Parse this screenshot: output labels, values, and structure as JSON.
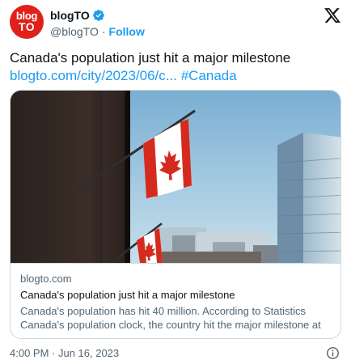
{
  "author": {
    "avatar_line1": "blog",
    "avatar_line2": "TO",
    "display_name": "blogTO",
    "handle": "@blogTO",
    "separator": "·",
    "follow_label": "Follow"
  },
  "tweet": {
    "text": "Canada's population just hit a major milestone",
    "link_text": "blogto.com/city/2023/06/c...",
    "hashtag": "#Canada"
  },
  "card": {
    "domain": "blogto.com",
    "title": "Canada's population just hit a major milestone",
    "description": "Canada's population has hit 40 million. According to Statistics Canada's population clock, the country hit the major milestone at ..."
  },
  "footer": {
    "timestamp": "4:00 PM · Jun 16, 2023"
  },
  "icons": {
    "verified": "verified-badge-icon",
    "x_logo": "x-logo-icon",
    "info": "info-icon"
  },
  "colors": {
    "accent": "#1d9bf0",
    "brand": "#e0211b",
    "muted_text": "#536471",
    "flag_red": "#d52b1e"
  }
}
